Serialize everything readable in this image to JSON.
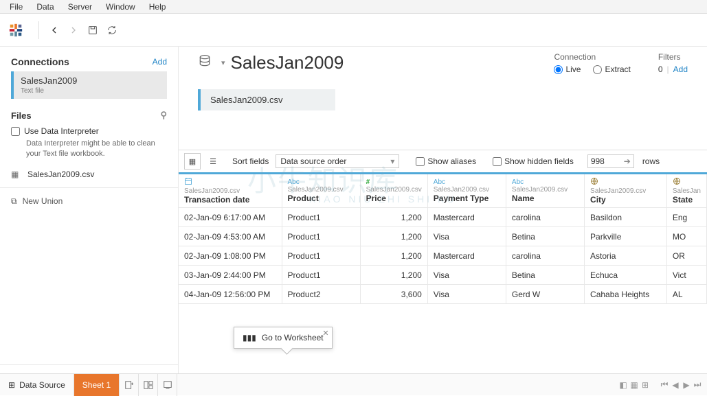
{
  "menu": {
    "file": "File",
    "data": "Data",
    "server": "Server",
    "window": "Window",
    "help": "Help"
  },
  "sidebar": {
    "connections_title": "Connections",
    "add": "Add",
    "conn": {
      "name": "SalesJan2009",
      "type": "Text file"
    },
    "files_title": "Files",
    "interpreter_chk": "Use Data Interpreter",
    "interpreter_hint": "Data Interpreter might be able to clean your Text file workbook.",
    "file_name": "SalesJan2009.csv",
    "new_union": "New Union"
  },
  "header": {
    "title": "SalesJan2009",
    "connection_label": "Connection",
    "live": "Live",
    "extract": "Extract",
    "filters_label": "Filters",
    "filters_count": "0",
    "filters_add": "Add",
    "pill": "SalesJan2009.csv"
  },
  "gridbar": {
    "sort_label": "Sort fields",
    "sort_value": "Data source order",
    "show_aliases": "Show aliases",
    "show_hidden": "Show hidden fields",
    "rows_value": "998",
    "rows_label": "rows"
  },
  "cols": [
    {
      "type": "date",
      "src": "SalesJan2009.csv",
      "name": "Transaction date"
    },
    {
      "type": "Abc",
      "src": "SalesJan2009.csv",
      "name": "Product"
    },
    {
      "type": "#",
      "src": "SalesJan2009.csv",
      "name": "Price"
    },
    {
      "type": "Abc",
      "src": "SalesJan2009.csv",
      "name": "Payment Type"
    },
    {
      "type": "Abc",
      "src": "SalesJan2009.csv",
      "name": "Name"
    },
    {
      "type": "globe",
      "src": "SalesJan2009.csv",
      "name": "City"
    },
    {
      "type": "globe",
      "src": "SalesJan",
      "name": "State"
    }
  ],
  "rows": [
    [
      "02-Jan-09 6:17:00 AM",
      "Product1",
      "1,200",
      "Mastercard",
      "carolina",
      "Basildon",
      "Eng"
    ],
    [
      "02-Jan-09 4:53:00 AM",
      "Product1",
      "1,200",
      "Visa",
      "Betina",
      "Parkville",
      "MO"
    ],
    [
      "02-Jan-09 1:08:00 PM",
      "Product1",
      "1,200",
      "Mastercard",
      "carolina",
      "Astoria",
      "OR"
    ],
    [
      "03-Jan-09 2:44:00 PM",
      "Product1",
      "1,200",
      "Visa",
      "Betina",
      "Echuca",
      "Vict"
    ],
    [
      "04-Jan-09 12:56:00 PM",
      "Product2",
      "3,600",
      "Visa",
      "Gerd W",
      "Cahaba Heights",
      "AL"
    ]
  ],
  "tooltip": "Go to Worksheet",
  "bottom": {
    "datasource": "Data Source",
    "sheet": "Sheet 1"
  }
}
